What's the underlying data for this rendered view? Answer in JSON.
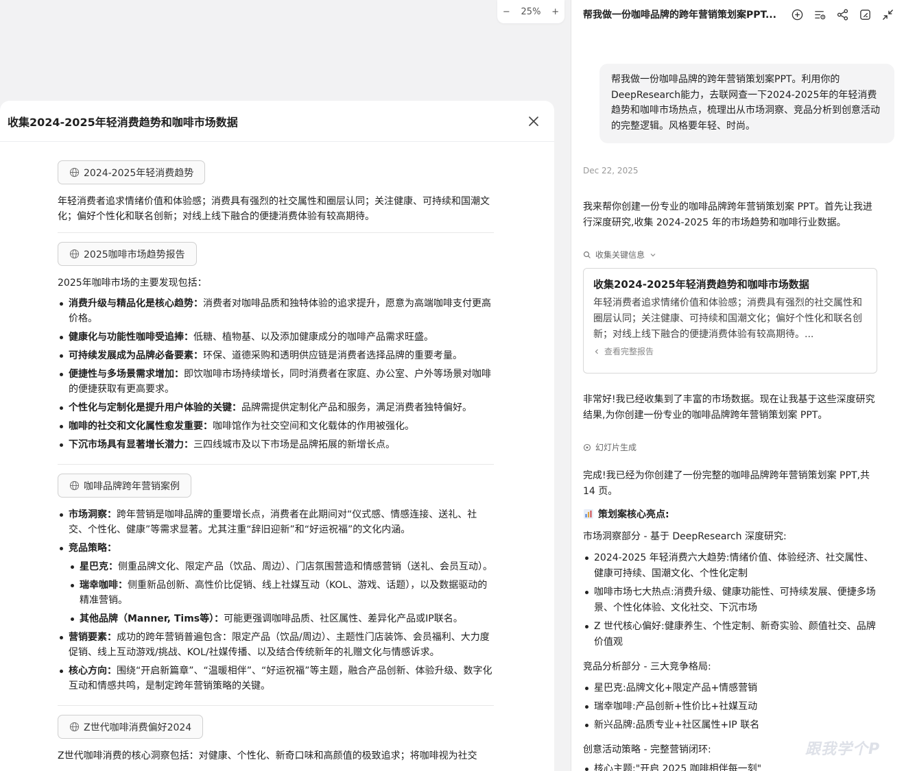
{
  "zoom": {
    "minus": "−",
    "value": "25%",
    "plus": "+"
  },
  "left_panel": {
    "title": "收集2024-2025年轻消费趋势和咖啡市场数据",
    "sections": [
      {
        "chip": "2024-2025年轻消费趋势",
        "text": "年轻消费者追求情绪价值和体验感；消费具有强烈的社交属性和圈层认同；关注健康、可持续和国潮文化；偏好个性化和联名创新；对线上线下融合的便捷消费体验有较高期待。"
      },
      {
        "chip": "2025咖啡市场趋势报告",
        "intro": "2025年咖啡市场的主要发现包括：",
        "items": [
          {
            "b": "消费升级与精品化是核心趋势：",
            "t": "消费者对咖啡品质和独特体验的追求提升，愿意为高端咖啡支付更高价格。"
          },
          {
            "b": "健康化与功能性咖啡受追捧：",
            "t": "低糖、植物基、以及添加健康成分的咖啡产品需求旺盛。"
          },
          {
            "b": "可持续发展成为品牌必备要素：",
            "t": "环保、道德采购和透明供应链是消费者选择品牌的重要考量。"
          },
          {
            "b": "便捷性与多场景需求增加：",
            "t": "即饮咖啡市场持续增长，同时消费者在家庭、办公室、户外等场景对咖啡的便捷获取有更高要求。"
          },
          {
            "b": "个性化与定制化是提升用户体验的关键：",
            "t": "品牌需提供定制化产品和服务，满足消费者独特偏好。"
          },
          {
            "b": "咖啡的社交和文化属性愈发重要：",
            "t": "咖啡馆作为社交空间和文化载体的作用被强化。"
          },
          {
            "b": "下沉市场具有显著增长潜力：",
            "t": "三四线城市及以下市场是品牌拓展的新增长点。"
          }
        ]
      },
      {
        "chip": "咖啡品牌跨年营销案例",
        "items": [
          {
            "b": "市场洞察：",
            "t": "跨年营销是咖啡品牌的重要增长点，消费者在此期间对“仪式感、情感连接、送礼、社交、个性化、健康”等需求显著。尤其注重“辞旧迎新”和“好运祝福”的文化内涵。"
          },
          {
            "b": "竞品策略：",
            "t": ""
          },
          {
            "b": "营销要素：",
            "t": "成功的跨年营销普遍包含：限定产品（饮品/周边）、主题性门店装饰、会员福利、大力度促销、线上互动游戏/挑战、KOL/社媒传播、以及结合传统新年的礼赠文化与情感诉求。"
          },
          {
            "b": "核心方向：",
            "t": "围绕“开启新篇章”、“温暖相伴”、“好运祝福”等主题，融合产品创新、体验升级、数字化互动和情感共鸣，是制定跨年营销策略的关键。"
          }
        ],
        "sub_items": [
          {
            "b": "星巴克：",
            "t": "侧重品牌文化、限定产品（饮品、周边）、门店氛围营造和情感营销（送礼、会员互动）。"
          },
          {
            "b": "瑞幸咖啡：",
            "t": "侧重新品创新、高性价比促销、线上社媒互动（KOL、游戏、话题），以及数据驱动的精准营销。"
          },
          {
            "b": "其他品牌（Manner, Tims等）：",
            "t": "可能更强调咖啡品质、社区属性、差异化产品或IP联名。"
          }
        ]
      },
      {
        "chip": "Z世代咖啡消费偏好2024",
        "text": "Z世代咖啡消费的核心洞察包括：对健康、个性化、新奇口味和高颜值的极致追求；将咖啡视为社交"
      }
    ]
  },
  "right_panel": {
    "title": "帮我做一份咖啡品牌的跨年营销策划案PPT...",
    "user_message": "帮我做一份咖啡品牌的跨年营销策划案PPT。利用你的DeepResearch能力，去联网查一下2024-2025年的年轻消费趋势和咖啡市场热点，梳理出从市场洞察、竞品分析到创意活动的完整逻辑。风格要年轻、时尚。",
    "date": "Dec 22, 2025",
    "reply1": "我来帮你创建一份专业的咖啡品牌跨年营销策划案 PPT。首先让我进行深度研究,收集 2024-2025 年的市场趋势和咖啡行业数据。",
    "step1": "收集关键信息",
    "card": {
      "title": "收集2024-2025年轻消费趋势和咖啡市场数据",
      "text": "年轻消费者追求情绪价值和体验感；消费具有强烈的社交属性和圈层认同；关注健康、可持续和国潮文化；偏好个性化和联名创新；对线上线下融合的便捷消费体验有较高期待。...",
      "link": "查看完整报告"
    },
    "reply2": "非常好!我已经收集到了丰富的市场数据。现在让我基于这些深度研究结果,为你创建一份专业的咖啡品牌跨年营销策划案 PPT。",
    "step2": "幻灯片生成",
    "reply3": "完成!我已经为你创建了一份完整的咖啡品牌跨年营销策划案 PPT,共 14 页。",
    "highlights_title": "策划案核心亮点:",
    "market_heading": "市场洞察部分 - 基于 DeepResearch 深度研究:",
    "market_items": [
      "2024-2025 年轻消费六大趋势:情绪价值、体验经济、社交属性、健康可持续、国潮文化、个性化定制",
      "咖啡市场七大热点:消费升级、健康功能性、可持续发展、便捷多场景、个性化体验、文化社交、下沉市场",
      "Z 世代核心偏好:健康养生、个性定制、新奇实验、颜值社交、品牌价值观"
    ],
    "competitor_heading": "竞品分析部分 - 三大竞争格局:",
    "competitor_items": [
      "星巴克:品牌文化+限定产品+情感营销",
      "瑞幸咖啡:产品创新+性价比+社媒互动",
      "新兴品牌:品质专业+社区属性+IP 联名"
    ],
    "creative_heading": "创意活动策略 - 完整营销闭环:",
    "creative_items": [
      "核心主题:\"开启 2025 咖啡相伴每一刻\""
    ]
  },
  "watermark": "跟我学个P"
}
